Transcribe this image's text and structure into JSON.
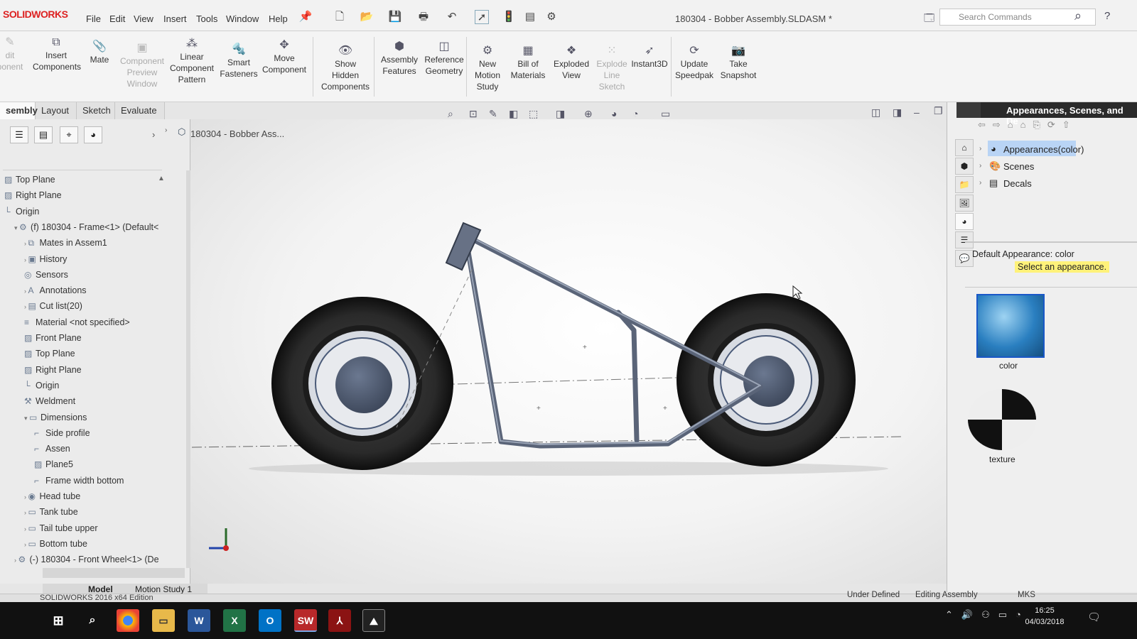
{
  "app": {
    "logo": "SOLIDWORKS",
    "doc_title": "180304 - Bobber Assembly.SLDASM *"
  },
  "menu": [
    "File",
    "Edit",
    "View",
    "Insert",
    "Tools",
    "Window",
    "Help"
  ],
  "search": {
    "placeholder": "Search Commands"
  },
  "ribbon": {
    "edit_component": "dit\nponent",
    "insert_components": "Insert\nComponents",
    "mate": "Mate",
    "component_preview": "Component\nPreview\nWindow",
    "linear_pattern": "Linear\nComponent\nPattern",
    "smart_fasteners": "Smart\nFasteners",
    "move_component": "Move\nComponent",
    "show_hidden": "Show\nHidden\nComponents",
    "assembly_features": "Assembly\nFeatures",
    "reference_geometry": "Reference\nGeometry",
    "new_motion_study": "New\nMotion\nStudy",
    "bill_of_materials": "Bill of\nMaterials",
    "exploded_view": "Exploded\nView",
    "explode_line_sketch": "Explode\nLine\nSketch",
    "instant3d": "Instant3D",
    "update_speedpak": "Update\nSpeedpak",
    "take_snapshot": "Take\nSnapshot"
  },
  "command_tabs": [
    "sembly",
    "Layout",
    "Sketch",
    "Evaluate"
  ],
  "viewport": {
    "breadcrumb": "180304 - Bobber Ass..."
  },
  "tree": [
    {
      "label": "Top Plane",
      "icon": "plane-icon",
      "indent": 0
    },
    {
      "label": "Right Plane",
      "icon": "plane-icon",
      "indent": 0
    },
    {
      "label": "Origin",
      "icon": "origin-icon",
      "indent": 0
    },
    {
      "label": "(f) 180304 - Frame<1> (Default<",
      "icon": "part-icon",
      "indent": 1
    },
    {
      "label": "Mates in Assem1",
      "icon": "mates-icon",
      "indent": 2
    },
    {
      "label": "History",
      "icon": "history-icon",
      "indent": 2
    },
    {
      "label": "Sensors",
      "icon": "sensors-icon",
      "indent": 2
    },
    {
      "label": "Annotations",
      "icon": "annotations-icon",
      "indent": 2
    },
    {
      "label": "Cut list(20)",
      "icon": "cutlist-icon",
      "indent": 2
    },
    {
      "label": "Material <not specified>",
      "icon": "material-icon",
      "indent": 2
    },
    {
      "label": "Front Plane",
      "icon": "plane-icon",
      "indent": 2
    },
    {
      "label": "Top Plane",
      "icon": "plane-icon",
      "indent": 2
    },
    {
      "label": "Right Plane",
      "icon": "plane-icon",
      "indent": 2
    },
    {
      "label": "Origin",
      "icon": "origin-icon",
      "indent": 2
    },
    {
      "label": "Weldment",
      "icon": "weldment-icon",
      "indent": 2
    },
    {
      "label": "Dimensions",
      "icon": "folder-icon",
      "indent": 2
    },
    {
      "label": "Side profile",
      "icon": "sketch-icon",
      "indent": 3
    },
    {
      "label": "Assen",
      "icon": "sketch-icon",
      "indent": 3
    },
    {
      "label": "Plane5",
      "icon": "plane-icon",
      "indent": 3
    },
    {
      "label": "Frame width bottom",
      "icon": "sketch-icon",
      "indent": 3
    },
    {
      "label": "Head tube",
      "icon": "structure-icon",
      "indent": 2
    },
    {
      "label": "Tank tube",
      "icon": "folder-icon",
      "indent": 2
    },
    {
      "label": "Tail tube upper",
      "icon": "folder-icon",
      "indent": 2
    },
    {
      "label": "Bottom tube",
      "icon": "folder-icon",
      "indent": 2
    },
    {
      "label": "(-) 180304 - Front Wheel<1> (De",
      "icon": "part-icon",
      "indent": 1
    }
  ],
  "right_panel": {
    "title": "Appearances, Scenes, and De",
    "items": [
      "Appearances(color)",
      "Scenes",
      "Decals"
    ],
    "default_appearance": "Default Appearance: color",
    "hint": "Select an appearance.",
    "thumb1": "color",
    "thumb2": "texture"
  },
  "bottom_tabs": [
    "Model",
    "Motion Study 1"
  ],
  "status": {
    "edition": "SOLIDWORKS 2016 x64 Edition",
    "state": "Under Defined",
    "mode": "Editing Assembly",
    "units": "MKS"
  },
  "clock": {
    "time": "16:25",
    "date": "04/03/2018"
  },
  "taskbar": {
    "apps": [
      "windows-start",
      "search",
      "chrome",
      "file-explorer",
      "word",
      "excel",
      "outlook",
      "solidworks",
      "acrobat",
      "photos"
    ]
  },
  "colors": {
    "accent_red": "#d22222",
    "highlight_yellow": "#fff27a",
    "selection_blue": "#b9d4f5"
  }
}
